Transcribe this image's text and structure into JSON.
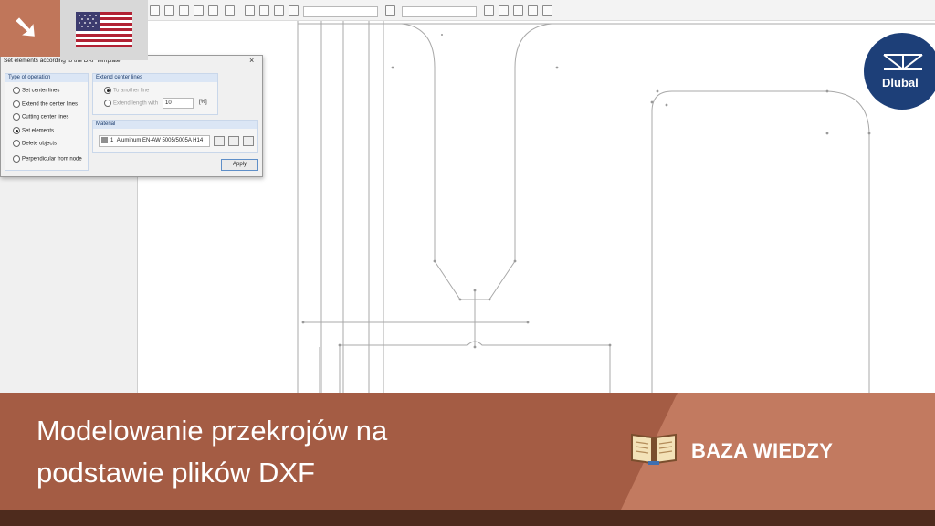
{
  "dialog": {
    "title": "Set elements according to the DXF template",
    "close_glyph": "×",
    "type_group": {
      "heading": "Type of operation",
      "options": [
        {
          "label": "Set center lines",
          "checked": false
        },
        {
          "label": "Extend the center lines",
          "checked": false
        },
        {
          "label": "Cutting center lines",
          "checked": false
        },
        {
          "label": "Set elements",
          "checked": true
        },
        {
          "label": "Delete objects",
          "checked": false
        },
        {
          "label": "Perpendicular from node",
          "checked": false
        }
      ]
    },
    "extend_group": {
      "heading": "Extend center lines",
      "option_another": "To another line",
      "option_length": "Extend length with",
      "length_value": "10",
      "length_unit": "[%]"
    },
    "material_group": {
      "heading": "Material",
      "number": "1",
      "name": "Aluminum EN-AW 5005/5005A H14"
    },
    "apply_label": "Apply"
  },
  "logo": {
    "text": "Dlubal",
    "color": "#1d3f78"
  },
  "banner": {
    "title_line1": "Modelowanie przekrojów na",
    "title_line2": "podstawie plików DXF",
    "kb_label": "BAZA WIEDZY",
    "color_dark": "#a45c44",
    "color_light": "#c27a60",
    "strip_color": "#4e2b1d"
  },
  "icons": {
    "badge": "arrow-down-right-icon",
    "flag": "us-flag-icon",
    "book": "open-book-icon"
  }
}
